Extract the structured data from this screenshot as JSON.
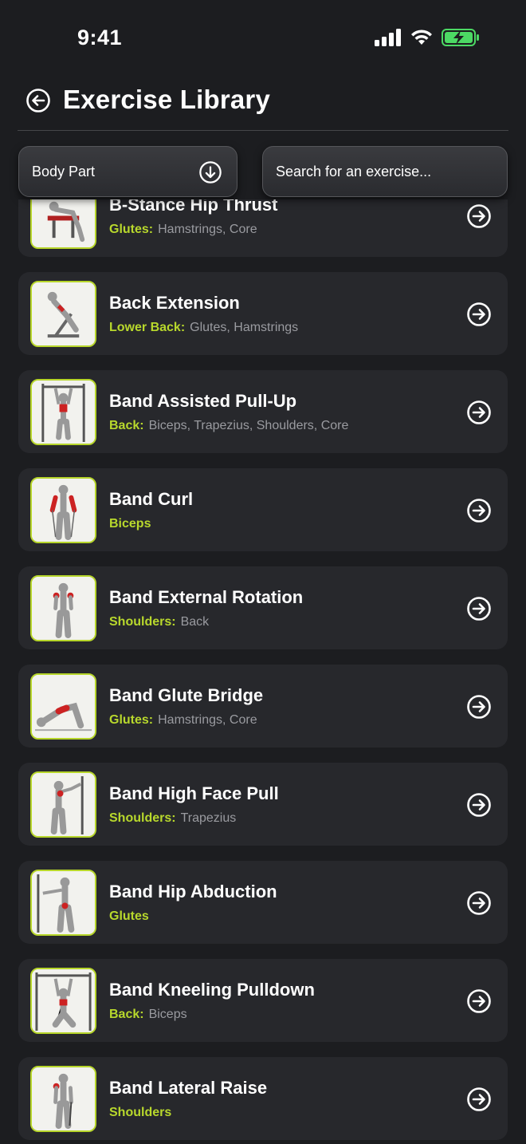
{
  "status": {
    "time": "9:41"
  },
  "header": {
    "title": "Exercise Library"
  },
  "filters": {
    "body_part_label": "Body Part",
    "search_placeholder": "Search for an exercise..."
  },
  "colors": {
    "accent": "#b8d82c",
    "card": "#27282c",
    "background": "#1c1d20",
    "battery": "#4cd964"
  },
  "exercises": [
    {
      "name": "B-Stance Hip Thrust",
      "primary": "Glutes:",
      "secondary": "Hamstrings, Core",
      "icon": "hip-thrust-figure"
    },
    {
      "name": "Back Extension",
      "primary": "Lower Back:",
      "secondary": "Glutes, Hamstrings",
      "icon": "back-extension-figure"
    },
    {
      "name": "Band Assisted Pull-Up",
      "primary": "Back:",
      "secondary": "Biceps, Trapezius, Shoulders, Core",
      "icon": "pull-up-figure"
    },
    {
      "name": "Band Curl",
      "primary": "Biceps",
      "secondary": "",
      "icon": "curl-figure"
    },
    {
      "name": "Band External Rotation",
      "primary": "Shoulders:",
      "secondary": "Back",
      "icon": "external-rotation-figure"
    },
    {
      "name": "Band Glute Bridge",
      "primary": "Glutes:",
      "secondary": "Hamstrings, Core",
      "icon": "glute-bridge-figure"
    },
    {
      "name": "Band High Face Pull",
      "primary": "Shoulders:",
      "secondary": "Trapezius",
      "icon": "face-pull-figure"
    },
    {
      "name": "Band Hip Abduction",
      "primary": "Glutes",
      "secondary": "",
      "icon": "hip-abduction-figure"
    },
    {
      "name": "Band Kneeling Pulldown",
      "primary": "Back:",
      "secondary": "Biceps",
      "icon": "kneeling-pulldown-figure"
    },
    {
      "name": "Band Lateral Raise",
      "primary": "Shoulders",
      "secondary": "",
      "icon": "lateral-raise-figure"
    }
  ]
}
